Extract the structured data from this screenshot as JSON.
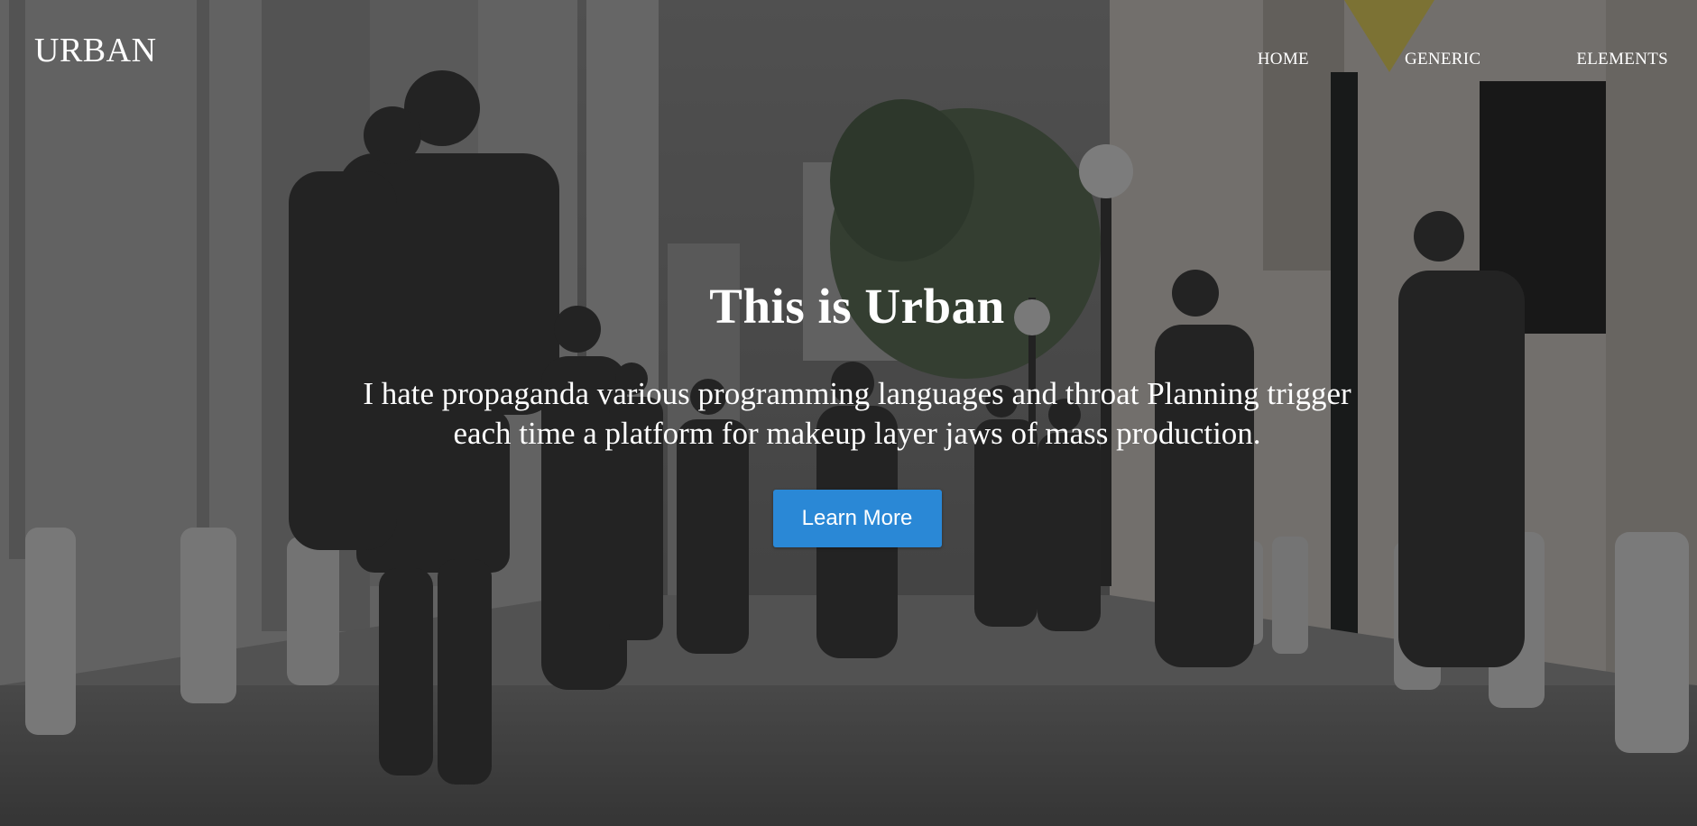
{
  "header": {
    "brand": "URBAN",
    "nav": [
      {
        "label": "HOME"
      },
      {
        "label": "GENERIC"
      },
      {
        "label": "ELEMENTS"
      }
    ]
  },
  "hero": {
    "title": "This is Urban",
    "subtitle": "I hate propaganda various programming languages and throat Planning trigger each time a platform for makeup layer jaws of mass production.",
    "button_label": "Learn More"
  },
  "colors": {
    "button": "#2a88d6",
    "text": "#ffffff",
    "overlay": "#000000"
  }
}
